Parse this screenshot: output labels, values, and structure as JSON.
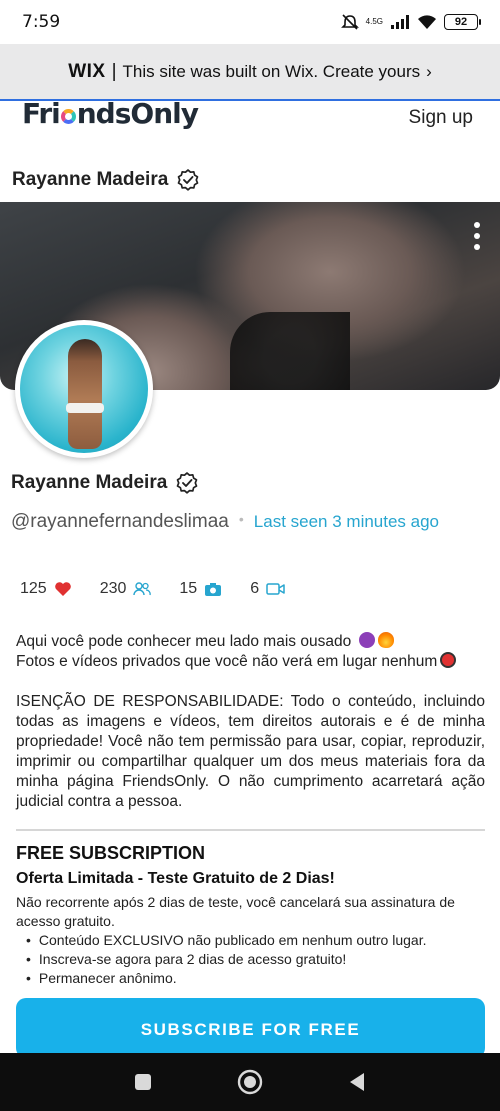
{
  "status_bar": {
    "time": "7:59",
    "network": "4.5G",
    "battery": "92",
    "icons": [
      "mute-icon",
      "signal-icon",
      "wifi-icon",
      "battery-icon"
    ]
  },
  "wix_banner": {
    "logo": "WIX",
    "separator": "|",
    "text": "This site was built on Wix. Create yours",
    "arrow": "›"
  },
  "header": {
    "brand_prefix": "Fri",
    "brand_suffix": "ndsOnly",
    "signup": "Sign up"
  },
  "profile": {
    "name": "Rayanne Madeira",
    "handle": "@rayannefernandeslimaa",
    "last_seen": "Last seen 3 minutes ago",
    "stats": {
      "likes": "125",
      "subscribers": "230",
      "photos": "15",
      "videos": "6"
    }
  },
  "bio": {
    "line1": "Aqui você pode conhecer meu lado mais ousado",
    "line2": "Fotos e vídeos privados que você não verá em lugar nenhum",
    "disclaimer": "ISENÇÃO DE RESPONSABILIDADE: Todo o conteúdo, incluindo todas as imagens e vídeos, tem direitos autorais e é de minha propriedade! Você não tem permissão para usar, copiar, reproduzir, imprimir ou compartilhar qualquer um dos meus materiais fora da minha página FriendsOnly. O não cumprimento acarretará ação judicial contra a pessoa."
  },
  "subscription": {
    "title": "FREE SUBSCRIPTION",
    "offer": "Oferta Limitada - Teste Gratuito de 2 Dias!",
    "description": "Não recorrente após 2 dias de teste, você cancelará sua assinatura de acesso gratuito.",
    "benefits": [
      "Conteúdo EXCLUSIVO não publicado em nenhum outro lugar.",
      "Inscreva-se agora para 2 dias de acesso gratuito!",
      "Permanecer anônimo."
    ],
    "button": "SUBSCRIBE FOR FREE"
  },
  "colors": {
    "accent": "#18b1ea",
    "link": "#27a5cf",
    "heart": "#e03131",
    "wix_banner_bg": "#e9e9ea"
  }
}
